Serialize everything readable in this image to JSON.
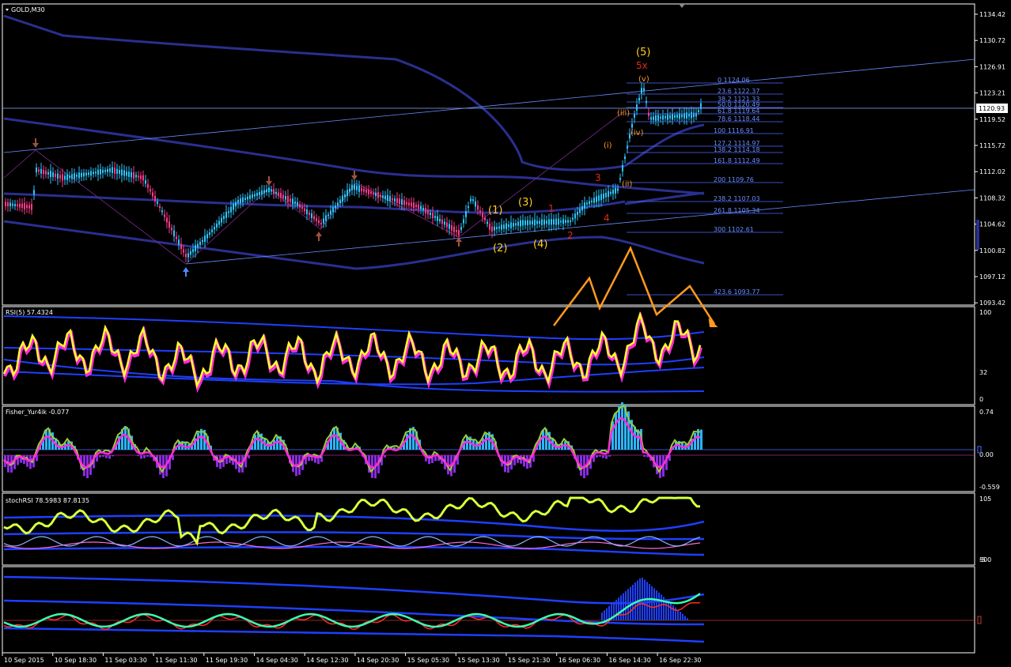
{
  "colors": {
    "background": "#000000",
    "grid_border": "#ffffff",
    "candle_up": "#2bc7ff",
    "candle_down": "#ff3b8b",
    "envelope": "#2a2f8f",
    "trendline": "#4a6cff",
    "fib": "#4a6cff",
    "rsi_main": "#ffff2b",
    "rsi_shadow": "#ff2bd8",
    "fisher_pos": "#2bb6ff",
    "fisher_neg": "#8a2be2",
    "fisher_line": "#ff2bd8",
    "fisher_line2": "#9acd32",
    "wave_yellow": "#ffd21a",
    "wave_red": "#e0291b",
    "wave_orange": "#ff9a1e"
  },
  "main_chart": {
    "title": "GOLD,M30",
    "current_price": "1120.93",
    "price_axis": [
      "1134.42",
      "1130.72",
      "1126.91",
      "1123.21",
      "1119.52",
      "1115.72",
      "1112.02",
      "1108.32",
      "1104.62",
      "1100.82",
      "1097.12",
      "1093.42"
    ],
    "fib_levels": [
      {
        "label": "0  1124.06"
      },
      {
        "label": "23.6  1122.37"
      },
      {
        "label": "38.2  1121.33"
      },
      {
        "label": "50.0  1120.49"
      },
      {
        "label": "61.8  1119.64"
      },
      {
        "label": "78.6  1118.44"
      },
      {
        "label": "100  1116.91"
      },
      {
        "label": "127.2  1114.97"
      },
      {
        "label": "138.2  1114.18"
      },
      {
        "label": "161.8  1112.49"
      },
      {
        "label": "200  1109.76"
      },
      {
        "label": "238.2  1107.03"
      },
      {
        "label": "261.8  1105.34"
      },
      {
        "label": "300  1102.61"
      },
      {
        "label": "423.6  1093.77"
      }
    ],
    "waves_yellow": [
      "(1)",
      "(2)",
      "(3)",
      "(4)",
      "(5)"
    ],
    "waves_red": [
      "1",
      "2",
      "3",
      "4",
      "5x"
    ],
    "waves_orange": [
      "(i)",
      "(ii)",
      "(iii)",
      "(iv)",
      "(v)"
    ]
  },
  "rsi": {
    "title": "RSI(5) 57.4324",
    "axis": [
      "100",
      "32",
      "0"
    ]
  },
  "fisher": {
    "title": "Fisher_Yur4ik -0.077",
    "axis": [
      "0.74",
      "0.00",
      "-0.559"
    ]
  },
  "panel4": {
    "title": "stochRSI 78.5983 87.8135",
    "axis": [
      "105",
      "-5"
    ]
  },
  "panel5": {
    "axis": [
      "500"
    ]
  },
  "time_axis": [
    "10 Sep 2015",
    "10 Sep 18:30",
    "11 Sep 03:30",
    "11 Sep 11:30",
    "11 Sep 19:30",
    "14 Sep 04:30",
    "14 Sep 12:30",
    "14 Sep 20:30",
    "15 Sep 05:30",
    "15 Sep 13:30",
    "15 Sep 21:30",
    "16 Sep 06:30",
    "16 Sep 14:30",
    "16 Sep 22:30"
  ]
}
